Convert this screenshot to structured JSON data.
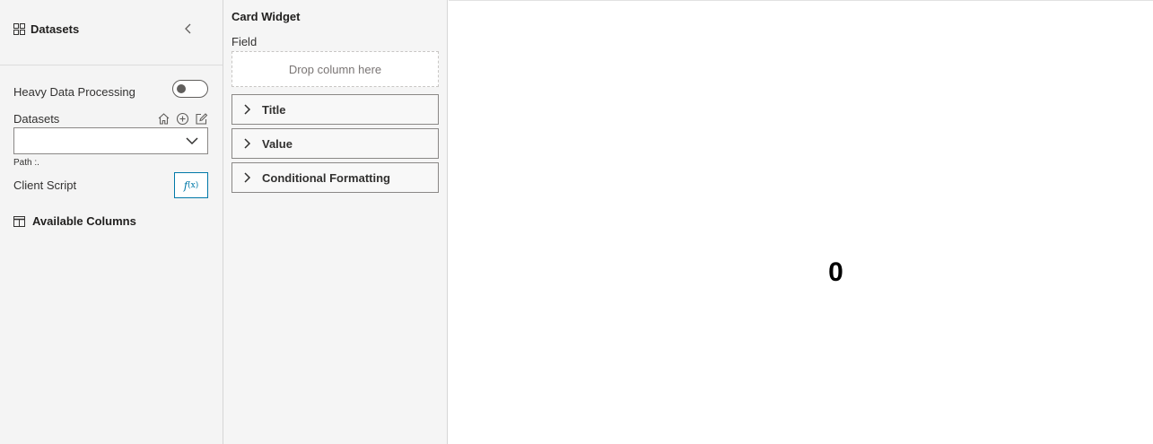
{
  "left_panel": {
    "title": "Datasets",
    "heavy_processing_label": "Heavy Data Processing",
    "heavy_processing_enabled": false,
    "datasets_label": "Datasets",
    "dataset_selected": "",
    "path_label": "Path :.",
    "client_script_label": "Client Script",
    "fx_label": "f",
    "fx_sub": "(x)",
    "available_columns_label": "Available Columns",
    "icons": [
      "grid-icon",
      "chevron-left-icon",
      "home-icon",
      "add-circle-icon",
      "edit-icon",
      "chevron-down-icon",
      "table-icon"
    ]
  },
  "properties_panel": {
    "title": "Card Widget",
    "field_label": "Field",
    "drop_placeholder": "Drop column here",
    "sections": [
      {
        "label": "Title"
      },
      {
        "label": "Value"
      },
      {
        "label": "Conditional Formatting"
      }
    ]
  },
  "canvas": {
    "card_value": "0"
  },
  "colors": {
    "panel_bg": "#f4f4f4",
    "accent": "#0078a8",
    "border": "#8a8886"
  }
}
